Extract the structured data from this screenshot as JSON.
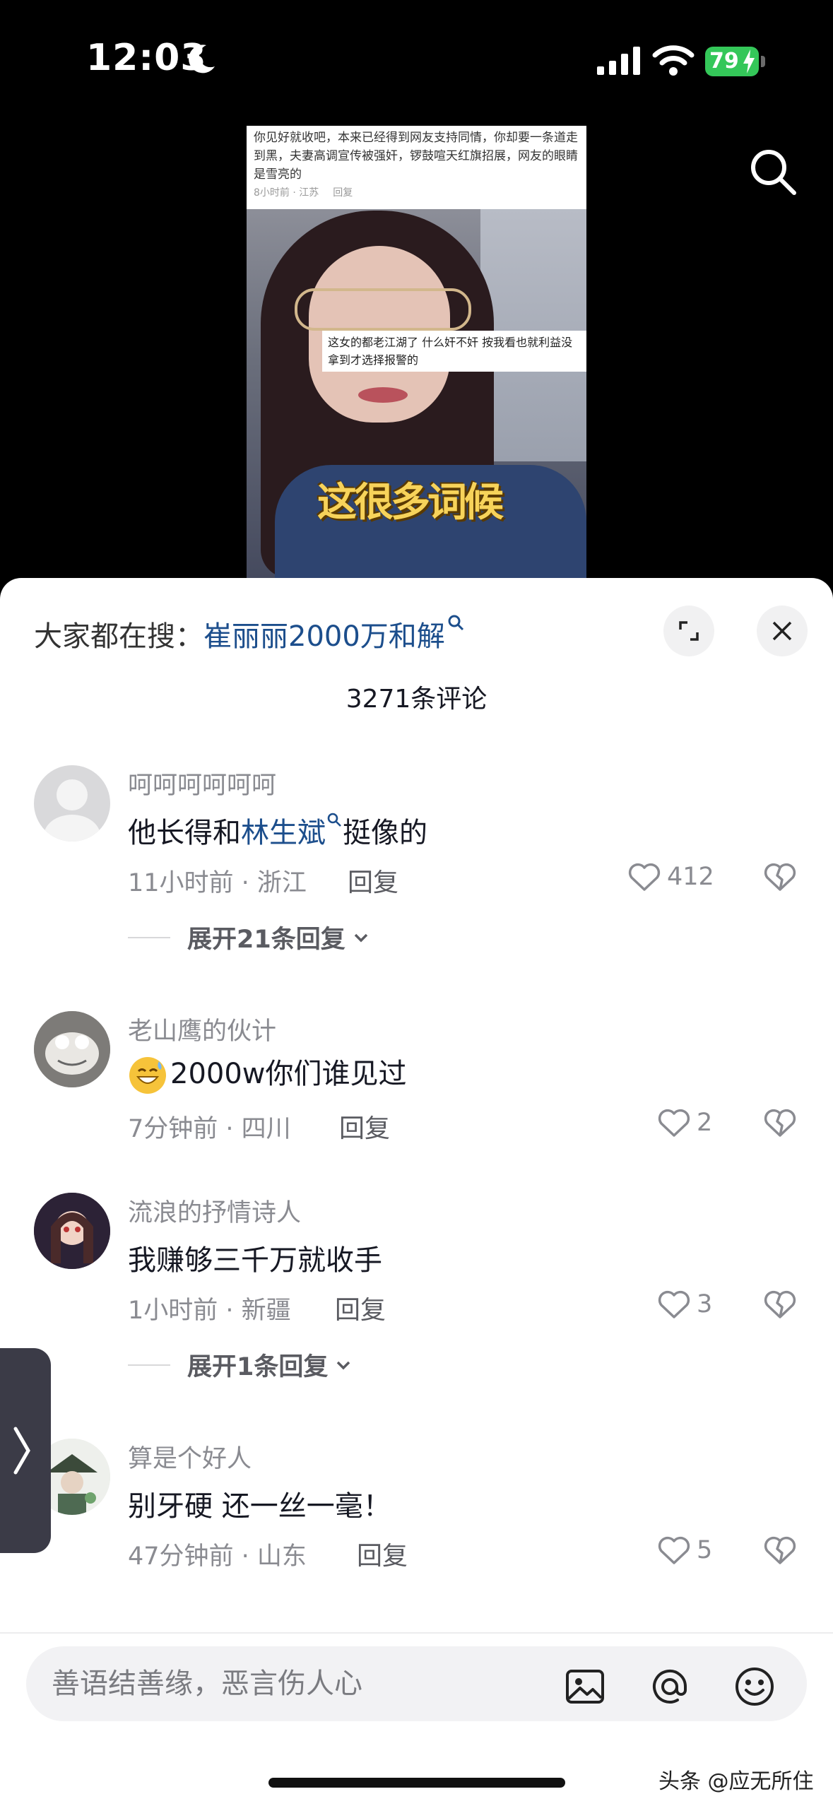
{
  "status_bar": {
    "time": "12:03",
    "battery": "79"
  },
  "video": {
    "caption_text": "你见好就收吧，本来已经得到网友支持同情，你却要一条道走到黑，夫妻高调宣传被强奸，锣鼓喧天红旗招展，网友的眼睛是雪亮的",
    "caption_time": "8小时前 · 江苏",
    "caption_reply": "回复",
    "overlay_comment": "这女的都老江湖了 什么奸不奸 按我看也就利益没拿到才选择报警的",
    "subtitle": "这很多词候"
  },
  "sheet": {
    "hot_search_label": "大家都在搜：",
    "hot_search_term": "崔丽丽2000万和解",
    "comment_count": "3271条评论"
  },
  "comments": [
    {
      "user": "呵呵呵呵呵呵",
      "text_before": "他长得和",
      "link": "林生斌",
      "text_after": "挺像的",
      "time_loc": "11小时前 · 浙江",
      "reply": "回复",
      "likes": "412",
      "expand": "展开21条回复"
    },
    {
      "user": "老山鹰的伙计",
      "emoji": "grinning-sweat-emoji",
      "text": "2000w你们谁见过",
      "time_loc": "7分钟前 · 四川",
      "reply": "回复",
      "likes": "2"
    },
    {
      "user": "流浪的抒情诗人",
      "text": "我赚够三千万就收手",
      "time_loc": "1小时前 · 新疆",
      "reply": "回复",
      "likes": "3",
      "expand": "展开1条回复"
    },
    {
      "user": "算是个好人",
      "text": "别牙硬 还一丝一毫！",
      "time_loc": "47分钟前 · 山东",
      "reply": "回复",
      "likes": "5"
    }
  ],
  "input": {
    "placeholder": "善语结善缘，恶言伤人心"
  },
  "watermark": "头条 @应无所住",
  "colors": {
    "link": "#1c4e8c",
    "battery": "#34c759",
    "meta": "#8a8b91"
  }
}
